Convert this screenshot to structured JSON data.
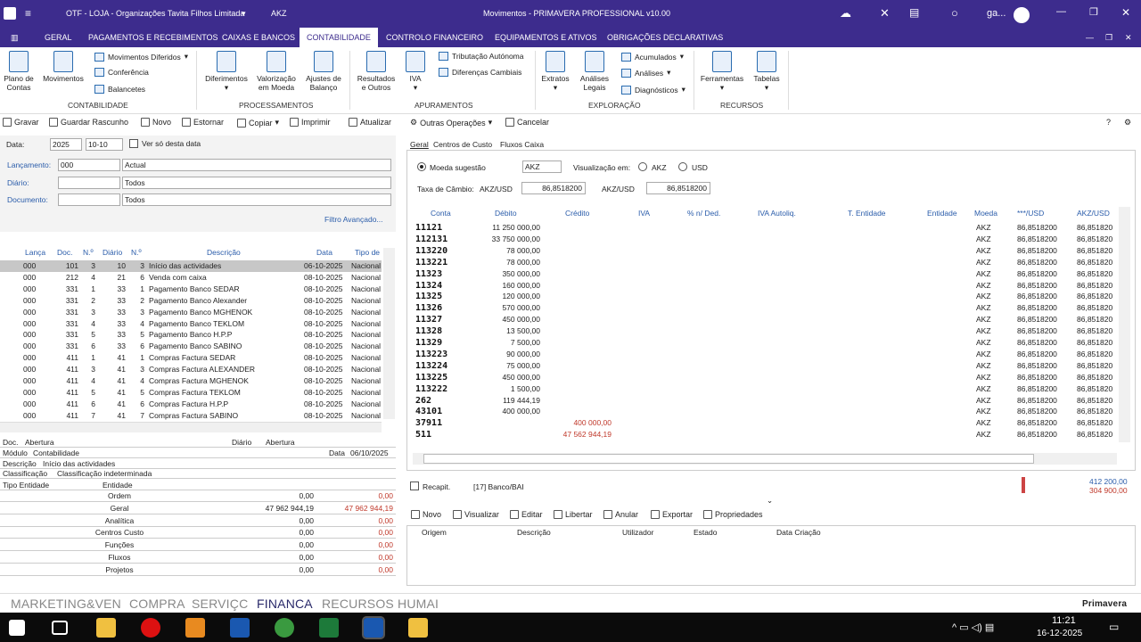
{
  "window": {
    "company": "OTF - LOJA - Organizações Tavita  Filhos Limitada",
    "currency": "AKZ",
    "title": "Movimentos - PRIMAVERA PROFESSIONAL v10.00",
    "user": "ga..."
  },
  "ribbon_tabs": [
    "GERAL",
    "PAGAMENTOS E RECEBIMENTOS",
    "CAIXAS E BANCOS",
    "CONTABILIDADE",
    "CONTROLO FINANCEIRO",
    "EQUIPAMENTOS E ATIVOS",
    "OBRIGAÇÕES DECLARATIVAS"
  ],
  "ribbon": {
    "plano": "Plano de\nContas",
    "movimentos": "Movimentos",
    "mov_diferidos": "Movimentos Diferidos",
    "conferencia": "Conferência",
    "balancetes": "Balancetes",
    "grp_contab": "CONTABILIDADE",
    "diferimentos": "Diferimentos",
    "valorizacao": "Valorização\nem Moeda",
    "ajustes": "Ajustes de\nBalanço",
    "grp_proc": "PROCESSAMENTOS",
    "resultados": "Resultados\ne Outros",
    "iva": "IVA",
    "trib": "Tributação Autónoma",
    "dif_camb": "Diferenças Cambiais",
    "grp_apur": "APURAMENTOS",
    "extratos": "Extratos",
    "analises_legais": "Análises\nLegais",
    "acumulados": "Acumulados",
    "analises": "Análises",
    "diagnosticos": "Diagnósticos",
    "grp_expl": "EXPLORAÇÃO",
    "ferramentas": "Ferramentas",
    "tabelas": "Tabelas",
    "grp_rec": "RECURSOS"
  },
  "toolbar": [
    "Gravar",
    "Guardar Rascunho",
    "Novo",
    "Estornar",
    "Copiar",
    "Imprimir",
    "Atualizar",
    "Outras Operações",
    "Cancelar"
  ],
  "form": {
    "data_label": "Data:",
    "year": "2025",
    "day": "10-10",
    "ver_so": "Ver só desta data",
    "lanc_label": "Lançamento:",
    "lanc_val": "000",
    "lanc_desc": "Actual",
    "diario_label": "Diário:",
    "diario_desc": "Todos",
    "doc_label": "Documento:",
    "doc_desc": "Todos",
    "filtro": "Filtro Avançado..."
  },
  "list_headers": [
    "Lança",
    "Doc.",
    "N.º",
    "Diário",
    "N.º",
    "Descrição",
    "Data",
    "Tipo de"
  ],
  "list_rows": [
    [
      "000",
      "101",
      "3",
      "10",
      "3",
      "Início das actividades",
      "06-10-2025",
      "Nacional"
    ],
    [
      "000",
      "212",
      "4",
      "21",
      "6",
      "Venda com caixa",
      "08-10-2025",
      "Nacional"
    ],
    [
      "000",
      "331",
      "1",
      "33",
      "1",
      "Pagamento Banco SEDAR",
      "08-10-2025",
      "Nacional"
    ],
    [
      "000",
      "331",
      "2",
      "33",
      "2",
      "Pagamento Banco Alexander",
      "08-10-2025",
      "Nacional"
    ],
    [
      "000",
      "331",
      "3",
      "33",
      "3",
      "Pagamento Banco MGHENOK",
      "08-10-2025",
      "Nacional"
    ],
    [
      "000",
      "331",
      "4",
      "33",
      "4",
      "Pagamento Banco TEKLOM",
      "08-10-2025",
      "Nacional"
    ],
    [
      "000",
      "331",
      "5",
      "33",
      "5",
      "Pagamento Banco H.P.P",
      "08-10-2025",
      "Nacional"
    ],
    [
      "000",
      "331",
      "6",
      "33",
      "6",
      "Pagamento Banco SABINO",
      "08-10-2025",
      "Nacional"
    ],
    [
      "000",
      "411",
      "1",
      "41",
      "1",
      "Compras Factura SEDAR",
      "08-10-2025",
      "Nacional"
    ],
    [
      "000",
      "411",
      "3",
      "41",
      "3",
      "Compras Factura ALEXANDER",
      "08-10-2025",
      "Nacional"
    ],
    [
      "000",
      "411",
      "4",
      "41",
      "4",
      "Compras Factura MGHENOK",
      "08-10-2025",
      "Nacional"
    ],
    [
      "000",
      "411",
      "5",
      "41",
      "5",
      "Compras Factura  TEKLOM",
      "08-10-2025",
      "Nacional"
    ],
    [
      "000",
      "411",
      "6",
      "41",
      "6",
      "Compras Factura H.P.P",
      "08-10-2025",
      "Nacional"
    ],
    [
      "000",
      "411",
      "7",
      "41",
      "7",
      "Compras Factura SABINO",
      "08-10-2025",
      "Nacional"
    ]
  ],
  "detail": {
    "doc_l": "Doc.",
    "doc_v": "Abertura",
    "diario_l": "Diário",
    "diario_v": "Abertura",
    "modulo_l": "Módulo",
    "modulo_v": "Contabilidade",
    "data_l": "Data",
    "data_v": "06/10/2025",
    "descr_l": "Descrição",
    "descr_v": "Início das actividades",
    "class_l": "Classificação",
    "class_v": "Classificação indeterminada",
    "tipo_l": "Tipo Entidade",
    "ent_l": "Entidade"
  },
  "totals": [
    [
      "Ordem",
      "0,00",
      "0,00"
    ],
    [
      "Geral",
      "47 962 944,19",
      "47 962 944,19"
    ],
    [
      "Analítica",
      "0,00",
      "0,00"
    ],
    [
      "Centros Custo",
      "0,00",
      "0,00"
    ],
    [
      "Funções",
      "0,00",
      "0,00"
    ],
    [
      "Fluxos",
      "0,00",
      "0,00"
    ],
    [
      "Projetos",
      "0,00",
      "0,00"
    ]
  ],
  "right_tabs": [
    "Geral",
    "Centros de Custo",
    "Fluxos Caixa"
  ],
  "moeda": {
    "sugestao": "Moeda sugestão",
    "currency": "AKZ",
    "visualizacao": "Visualização em:",
    "opt1": "AKZ",
    "opt2": "USD",
    "taxa_label": "Taxa de Câmbio:",
    "pair1": "AKZ/USD",
    "rate1": "86,8518200",
    "pair2": "AKZ/USD",
    "rate2": "86,8518200"
  },
  "grid_headers": [
    "Conta",
    "Débito",
    "Crédito",
    "IVA",
    "% n/ Ded.",
    "IVA Autoliq.",
    "T. Entidade",
    "Entidade",
    "Moeda",
    "***/USD",
    "AKZ/USD"
  ],
  "grid_rows": [
    [
      "11121",
      "11 250 000,00",
      "",
      "AKZ",
      "86,8518200",
      "86,851820"
    ],
    [
      "112131",
      "33 750 000,00",
      "",
      "AKZ",
      "86,8518200",
      "86,851820"
    ],
    [
      "113220",
      "78 000,00",
      "",
      "AKZ",
      "86,8518200",
      "86,851820"
    ],
    [
      "113221",
      "78 000,00",
      "",
      "AKZ",
      "86,8518200",
      "86,851820"
    ],
    [
      "11323",
      "350 000,00",
      "",
      "AKZ",
      "86,8518200",
      "86,851820"
    ],
    [
      "11324",
      "160 000,00",
      "",
      "AKZ",
      "86,8518200",
      "86,851820"
    ],
    [
      "11325",
      "120 000,00",
      "",
      "AKZ",
      "86,8518200",
      "86,851820"
    ],
    [
      "11326",
      "570 000,00",
      "",
      "AKZ",
      "86,8518200",
      "86,851820"
    ],
    [
      "11327",
      "450 000,00",
      "",
      "AKZ",
      "86,8518200",
      "86,851820"
    ],
    [
      "11328",
      "13 500,00",
      "",
      "AKZ",
      "86,8518200",
      "86,851820"
    ],
    [
      "11329",
      "7 500,00",
      "",
      "AKZ",
      "86,8518200",
      "86,851820"
    ],
    [
      "113223",
      "90 000,00",
      "",
      "AKZ",
      "86,8518200",
      "86,851820"
    ],
    [
      "113224",
      "75 000,00",
      "",
      "AKZ",
      "86,8518200",
      "86,851820"
    ],
    [
      "113225",
      "450 000,00",
      "",
      "AKZ",
      "86,8518200",
      "86,851820"
    ],
    [
      "113222",
      "1 500,00",
      "",
      "AKZ",
      "86,8518200",
      "86,851820"
    ],
    [
      "262",
      "119 444,19",
      "",
      "AKZ",
      "86,8518200",
      "86,851820"
    ],
    [
      "43101",
      "400 000,00",
      "",
      "AKZ",
      "86,8518200",
      "86,851820"
    ],
    [
      "37911",
      "",
      "400 000,00",
      "AKZ",
      "86,8518200",
      "86,851820"
    ],
    [
      "511",
      "",
      "47 562 944,19",
      "AKZ",
      "86,8518200",
      "86,851820"
    ]
  ],
  "recapit": {
    "label": "Recapit.",
    "conta": "[17] Banco/BAI",
    "v1": "412 200,00",
    "v2": "304 900,00"
  },
  "bottom_toolbar": [
    "Novo",
    "Visualizar",
    "Editar",
    "Libertar",
    "Anular",
    "Exportar",
    "Propriedades"
  ],
  "bottom_headers": [
    "Origem",
    "Descrição",
    "Utilizador",
    "Estado",
    "Data Criação"
  ],
  "bottom_tabs": [
    "MARKETING&VEN",
    "COMPRA",
    "SERVIÇC",
    "FINANCA",
    "RECURSOS HUMAI"
  ],
  "brand": "Primavera",
  "clock": {
    "time": "11:21",
    "date": "16-12-2025"
  }
}
